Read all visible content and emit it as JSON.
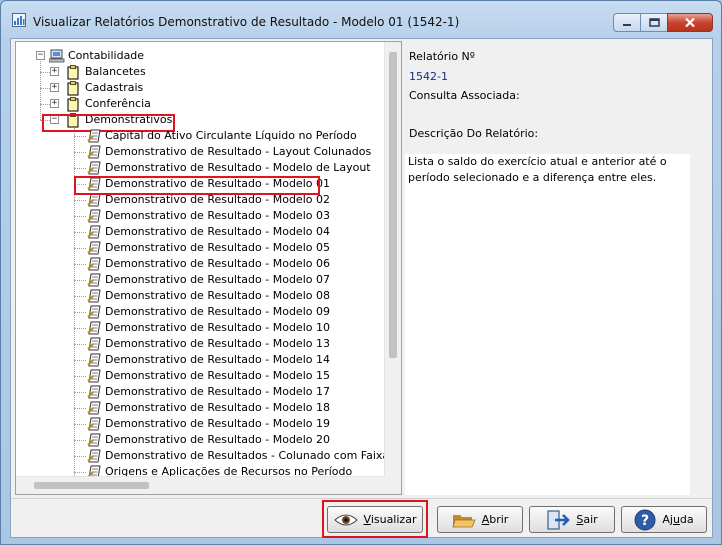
{
  "window": {
    "title": "Visualizar Relatórios Demonstrativo de Resultado - Modelo 01 (1542-1)"
  },
  "tree": {
    "root": "Contabilidade",
    "folders": [
      "Balancetes",
      "Cadastrais",
      "Conferência",
      "Demonstrativos"
    ],
    "expanded_folder": "Demonstrativos",
    "selected_item": "Demonstrativo de Resultado - Modelo 01",
    "items": [
      "Capital do Ativo Circulante Líquido no Período",
      "Demonstrativo de Resultado - Layout Colunados",
      "Demonstrativo de Resultado - Modelo de Layout",
      "Demonstrativo de Resultado - Modelo 01",
      "Demonstrativo de Resultado - Modelo 02",
      "Demonstrativo de Resultado - Modelo 03",
      "Demonstrativo de Resultado - Modelo 04",
      "Demonstrativo de Resultado - Modelo 05",
      "Demonstrativo de Resultado - Modelo 06",
      "Demonstrativo de Resultado - Modelo 07",
      "Demonstrativo de Resultado - Modelo 08",
      "Demonstrativo de Resultado - Modelo 09",
      "Demonstrativo de Resultado - Modelo 10",
      "Demonstrativo de Resultado - Modelo 13",
      "Demonstrativo de Resultado - Modelo 14",
      "Demonstrativo de Resultado - Modelo 15",
      "Demonstrativo de Resultado - Modelo 17",
      "Demonstrativo de Resultado - Modelo 18",
      "Demonstrativo de Resultado - Modelo 19",
      "Demonstrativo de Resultado - Modelo 20",
      "Demonstrativo de Resultados - Colunado com Faixa d",
      "Origens e Aplicações de Recursos no Período"
    ]
  },
  "details": {
    "report_number_label": "Relatório Nº",
    "report_number_value": "1542-1",
    "associated_query_label": "Consulta Associada:",
    "description_label": "Descrição Do Relatório:",
    "description_text": "Lista o saldo do exercício atual e anterior até o período selecionado e a diferença entre eles."
  },
  "buttons": {
    "visualizar": {
      "pre": "",
      "ul": "V",
      "post": "isualizar"
    },
    "abrir": {
      "pre": "",
      "ul": "A",
      "post": "brir"
    },
    "sair": {
      "pre": "",
      "ul": "S",
      "post": "air"
    },
    "ajuda": {
      "pre": "Aj",
      "ul": "u",
      "post": "da"
    }
  },
  "colors": {
    "highlight": "#e0141e",
    "value_text": "#1b2b8a"
  }
}
